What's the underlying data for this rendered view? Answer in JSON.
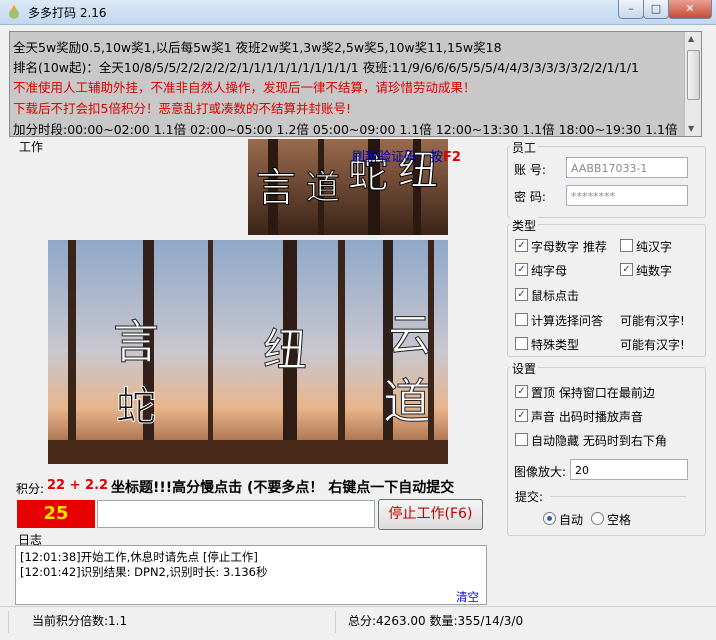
{
  "window": {
    "title": "多多打码 2.16",
    "min_label": "–",
    "max_label": "□",
    "close_label": "✕"
  },
  "notice": {
    "lines": [
      "全天5w奖励0.5,10w奖1,以后每5w奖1 夜班2w奖1,3w奖2,5w奖5,10w奖11,15w奖18",
      "排名(10w起)：全天10/8/5/5/2/2/2/2/2/1/1/1/1/1/1/1/1/1/1 夜班:11/9/6/6/6/5/5/5/4/4/3/3/3/3/3/2/2/1/1/1",
      "不准使用人工辅助外挂，不准非自然人操作，发现后一律不结算，请珍惜劳动成果！",
      "下载后不打会扣5倍积分！恶意乱打或凑数的不结算并封账号!",
      "加分时段:00:00~02:00 1.1倍 02:00~05:00 1.2倍 05:00~09:00 1.1倍 12:00~13:30 1.1倍 18:00~19:30 1.1倍"
    ],
    "red_color": "#e00000"
  },
  "work": {
    "label": "工作",
    "f2_hint": "刷新验证码，按",
    "f2_key": "F2",
    "captcha_top_chars": [
      "言",
      "道",
      "蛇",
      "纽"
    ],
    "captcha_main_chars": [
      "言",
      "蛇",
      "纽",
      "云",
      "道"
    ],
    "score_label": "积分:",
    "score_value": "22 + 2.2",
    "instruction": "坐标题!!!高分慢点击 (不要多点！ 右键点一下自动提交",
    "counter": "25",
    "answer_value": "",
    "stop_button": "停止工作(F6)"
  },
  "log": {
    "label": "日志",
    "lines": [
      "[12:01:38]开始工作,休息时请先点 [停止工作]",
      "[12:01:42]识别结果: DPN2,识别时长: 3.136秒"
    ],
    "clear_label": "清空"
  },
  "staff": {
    "label": "员工",
    "account_label": "账  号:",
    "account_value": "AABB17033-1",
    "password_label": "密  码:",
    "password_value": "********"
  },
  "type_group": {
    "label": "类型",
    "options": [
      {
        "label": "字母数字 推荐",
        "checked": true
      },
      {
        "label": "纯汉字",
        "checked": false
      },
      {
        "label": "纯字母",
        "checked": true
      },
      {
        "label": "纯数字",
        "checked": true
      },
      {
        "label": "鼠标点击",
        "checked": true
      },
      {
        "label": "计算选择问答",
        "checked": false
      },
      {
        "label": "特殊类型",
        "checked": false
      }
    ],
    "maybe_hanzi_1": "可能有汉字!",
    "maybe_hanzi_2": "可能有汉字!"
  },
  "settings": {
    "label": "设置",
    "options": [
      {
        "label": "置顶 保持窗口在最前边",
        "checked": true
      },
      {
        "label": "声音 出码时播放声音",
        "checked": true
      },
      {
        "label": "自动隐藏 无码时到右下角",
        "checked": false
      }
    ],
    "zoom_label": "图像放大:",
    "zoom_value": "20",
    "submit_label": "提交:",
    "submit_auto": "自动",
    "submit_space": "空格",
    "submit_selected": "自动"
  },
  "status": {
    "multiplier": "当前积分倍数:1.1",
    "totals": "总分:4263.00 数量:355/14/3/0"
  }
}
